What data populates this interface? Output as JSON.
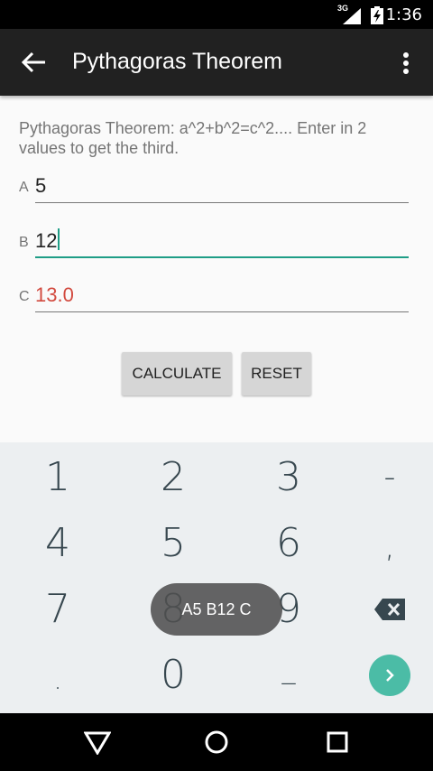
{
  "status_bar": {
    "network": "3G",
    "time": "1:36",
    "icons": [
      "signal-icon",
      "battery-charging-icon"
    ]
  },
  "app_bar": {
    "title": "Pythagoras Theorem",
    "back_icon": "arrow-back-icon",
    "menu_icon": "overflow-menu-icon"
  },
  "description": "Pythagoras Theorem: a^2+b^2=c^2.... Enter in 2 values to get the third.",
  "fields": [
    {
      "label": "A",
      "value": "5"
    },
    {
      "label": "B",
      "value": "12"
    },
    {
      "label": "C",
      "value": "13.0"
    }
  ],
  "buttons": {
    "calculate": "CALCULATE",
    "reset": "RESET"
  },
  "keyboard": {
    "rows": [
      [
        "1",
        "2",
        "3",
        "-"
      ],
      [
        "4",
        "5",
        "6",
        ","
      ],
      [
        "7",
        "8",
        "9",
        "backspace"
      ],
      [
        ".",
        "0",
        "_",
        "go"
      ]
    ]
  },
  "toast": "A5 B12 C",
  "colors": {
    "accent": "#1e9d86",
    "result": "#d24a3f",
    "app_bar": "#212121",
    "keyboard_bg": "#eceff1",
    "go_button": "#4bbca6"
  }
}
